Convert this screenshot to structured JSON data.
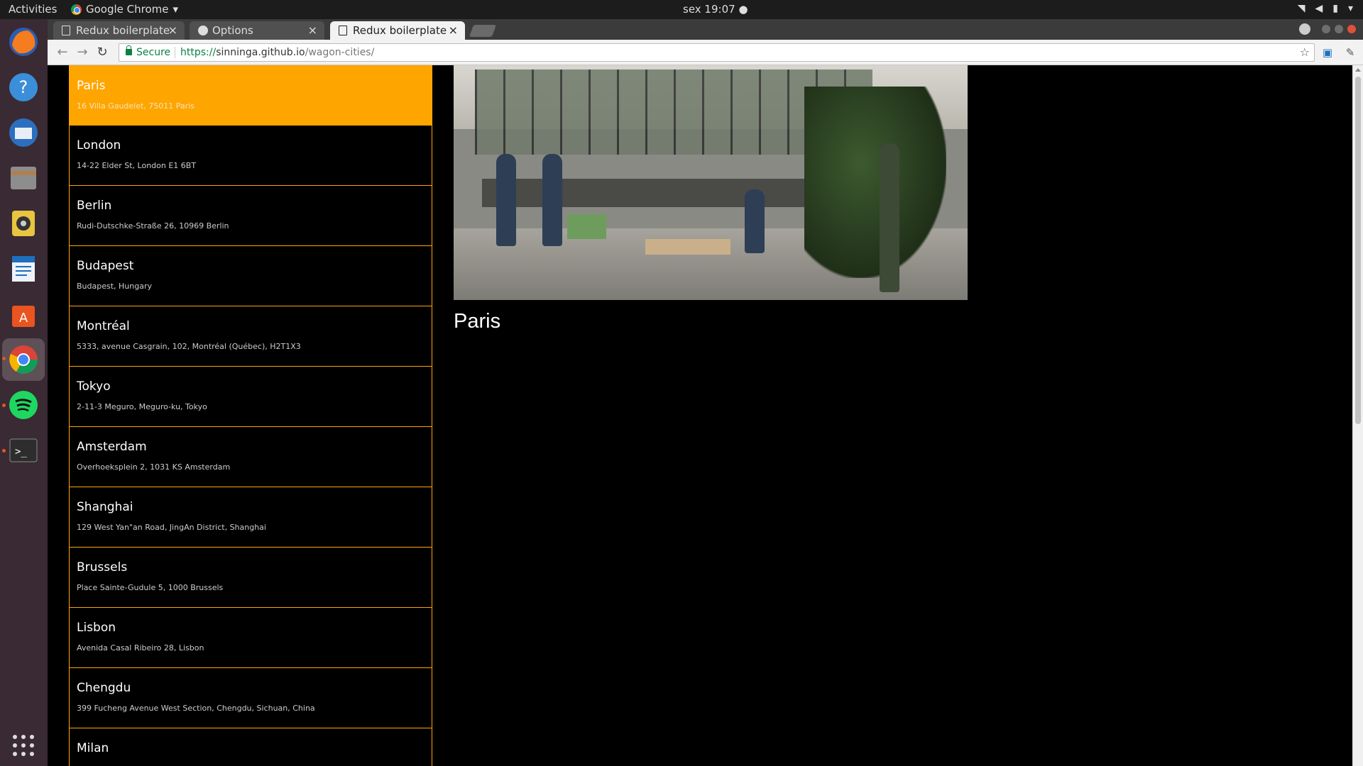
{
  "topbar": {
    "activities": "Activities",
    "app_name": "Google Chrome",
    "clock": "sex 19:07"
  },
  "browser": {
    "tabs": [
      {
        "title": "Redux boilerplate",
        "icon": "page-icon"
      },
      {
        "title": "Options",
        "icon": "github-icon"
      },
      {
        "title": "Redux boilerplate",
        "icon": "page-icon",
        "active": true
      }
    ],
    "omnibox": {
      "secure_label": "Secure",
      "url_scheme": "https://",
      "url_host": "sinninga.github.io",
      "url_path": "/wagon-cities/"
    }
  },
  "colors": {
    "accent": "#ffa500",
    "page_bg": "#000000"
  },
  "cities": [
    {
      "name": "Paris",
      "address": "16 Villa Gaudelet, 75011 Paris",
      "selected": true
    },
    {
      "name": "London",
      "address": "14-22 Elder St, London E1 6BT"
    },
    {
      "name": "Berlin",
      "address": "Rudi-Dutschke-Straße 26, 10969 Berlin"
    },
    {
      "name": "Budapest",
      "address": "Budapest, Hungary"
    },
    {
      "name": "Montréal",
      "address": "5333, avenue Casgrain, 102, Montréal (Québec), H2T1X3"
    },
    {
      "name": "Tokyo",
      "address": "2-11-3 Meguro, Meguro-ku, Tokyo"
    },
    {
      "name": "Amsterdam",
      "address": "Overhoeksplein 2, 1031 KS Amsterdam"
    },
    {
      "name": "Shanghai",
      "address": "129 West Yan\"an Road, JingAn District, Shanghai"
    },
    {
      "name": "Brussels",
      "address": "Place Sainte-Gudule 5, 1000 Brussels"
    },
    {
      "name": "Lisbon",
      "address": "Avenida Casal Ribeiro 28, Lisbon"
    },
    {
      "name": "Chengdu",
      "address": "399 Fucheng Avenue West Section, Chengdu, Sichuan, China"
    },
    {
      "name": "Milan",
      "address": ""
    }
  ],
  "selected_city": {
    "name": "Paris"
  }
}
